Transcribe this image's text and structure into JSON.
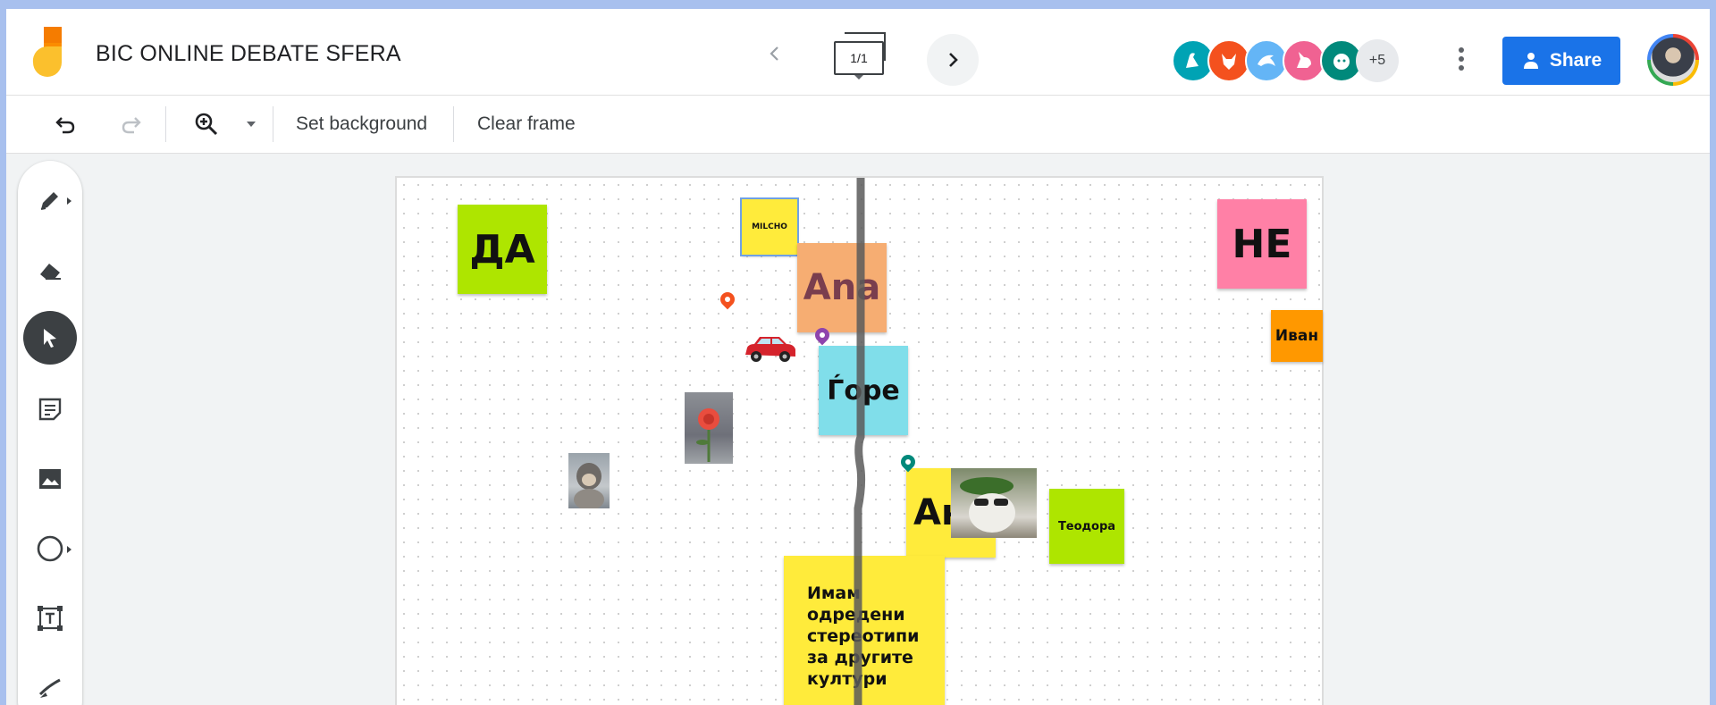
{
  "header": {
    "title": "BIC ONLINE DEBATE SFERA",
    "frame_counter": "1/1",
    "more_collaborators": "+5",
    "share_label": "Share",
    "collaborators": [
      {
        "icon": "goose-icon",
        "color": "#00a3b4"
      },
      {
        "icon": "fox-icon",
        "color": "#f4511e"
      },
      {
        "icon": "dolphin-icon",
        "color": "#64b5f6"
      },
      {
        "icon": "unicorn-icon",
        "color": "#f06292"
      },
      {
        "icon": "tiger-icon",
        "color": "#00897b"
      }
    ]
  },
  "toolbar": {
    "set_background_label": "Set background",
    "clear_frame_label": "Clear frame"
  },
  "tools": [
    "pen-tool",
    "eraser-tool",
    "select-tool",
    "sticky-note-tool",
    "image-tool",
    "circle-tool",
    "text-box-tool",
    "laser-tool"
  ],
  "canvas": {
    "notes": {
      "da": "ДА",
      "ne": "НЕ",
      "milcho": "MILCHO",
      "ana": "Ana",
      "ivan": "Иван",
      "gjore": "Ѓоре",
      "an_partial": "Ан",
      "teodora": "Теодора",
      "stereotypes": "Имам одредени стереотипи за другите култури"
    },
    "colors": {
      "lime": "#aee500",
      "pink": "#ff80a6",
      "yellow": "#ffeb3b",
      "orange_light": "#f6ad72",
      "orange": "#ff9800",
      "cyan": "#80deea",
      "ana_text": "#7a3e4e"
    }
  }
}
